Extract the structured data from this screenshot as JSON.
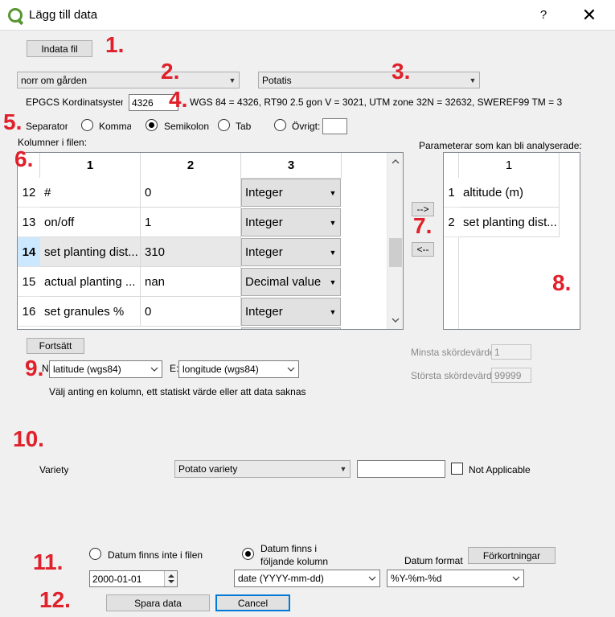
{
  "window": {
    "title": "Lägg till data",
    "help": "?",
    "close": "✕"
  },
  "markers": [
    "1.",
    "2.",
    "3.",
    "4.",
    "5.",
    "6.",
    "7.",
    "8.",
    "9.",
    "10.",
    "11.",
    "12."
  ],
  "input_file_button": "Indata fil",
  "field_combo": {
    "value": "norr om gården"
  },
  "crop_combo": {
    "value": "Potatis"
  },
  "epsg": {
    "label": "EPGCS Kordinatsystem",
    "value": "4326",
    "hint": "WGS 84 = 4326, RT90 2.5 gon V = 3021, UTM zone 32N = 32632, SWEREF99 TM = 3"
  },
  "separator": {
    "label": "Separator",
    "options": [
      {
        "label": "Komma",
        "checked": false
      },
      {
        "label": "Semikolon",
        "checked": true
      },
      {
        "label": "Tab",
        "checked": false
      },
      {
        "label": "Övrigt:",
        "checked": false
      }
    ],
    "other_value": ""
  },
  "columns_label": "Kolumner i filen:",
  "columns_table": {
    "headers": [
      "1",
      "2",
      "3"
    ],
    "rows": [
      {
        "num": "12",
        "name": "#",
        "value": "0",
        "type": "Integer",
        "selected": false
      },
      {
        "num": "13",
        "name": "on/off",
        "value": "1",
        "type": "Integer",
        "selected": false
      },
      {
        "num": "14",
        "name": "set planting dist...",
        "value": "310",
        "type": "Integer",
        "selected": true
      },
      {
        "num": "15",
        "name": "actual planting ...",
        "value": "nan",
        "type": "Decimal value",
        "selected": false
      },
      {
        "num": "16",
        "name": "set granules %",
        "value": "0",
        "type": "Integer",
        "selected": false
      }
    ]
  },
  "move_right_button": "-->",
  "move_left_button": "<--",
  "params_label": "Parameterar som kan bli analyserade:",
  "params_table": {
    "header": "1",
    "rows": [
      {
        "num": "1",
        "name": "altitude (m)"
      },
      {
        "num": "2",
        "name": "set planting dist..."
      }
    ]
  },
  "continue_button": "Fortsätt",
  "coords": {
    "north_label": "N:",
    "north_value": "latitude (wgs84)",
    "east_label": "E:",
    "east_value": "longitude (wgs84)",
    "hint": "Välj anting en kolumn, ett statiskt värde eller att data saknas"
  },
  "yield": {
    "min_label": "Minsta skördevärde",
    "min_value": "1",
    "max_label": "Största skördevärde",
    "max_value": "99999"
  },
  "variety": {
    "label": "Variety",
    "combo_value": "Potato variety",
    "text_value": "",
    "not_applicable_label": "Not Applicable",
    "not_applicable_checked": false
  },
  "date": {
    "no_date_label": "Datum finns inte i filen",
    "no_date_checked": false,
    "in_column_label_1": "Datum finns i",
    "in_column_label_2": "följande kolumn",
    "in_column_checked": true,
    "format_label": "Datum format",
    "abbrev_button": "Förkortningar",
    "date_value": "2000-01-01",
    "column_value": "date (YYYY-mm-dd)",
    "format_value": "%Y-%m-%d"
  },
  "save_button": "Spara data",
  "cancel_button": "Cancel",
  "colors": {
    "marker": "#e0202a",
    "selection": "#cce8ff",
    "focus": "#0078d7",
    "qgis_green": "#589632"
  }
}
